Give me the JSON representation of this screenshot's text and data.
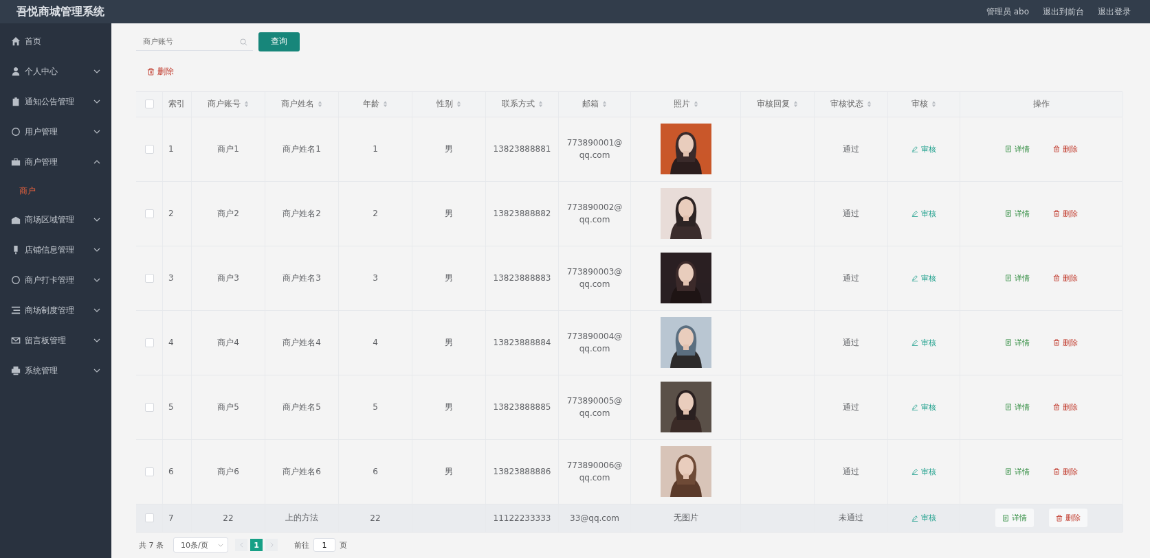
{
  "header": {
    "title": "吾悦商城管理系统",
    "links": [
      "管理员 abo",
      "退出到前台",
      "退出登录"
    ]
  },
  "sidebar": {
    "items": [
      {
        "label": "首页"
      },
      {
        "label": "个人中心",
        "expanded": false
      },
      {
        "label": "通知公告管理",
        "expanded": false
      },
      {
        "label": "用户管理",
        "expanded": false
      },
      {
        "label": "商户管理",
        "expanded": true,
        "children": [
          {
            "label": "商户",
            "selected": true
          }
        ]
      },
      {
        "label": "商场区域管理",
        "expanded": false
      },
      {
        "label": "店铺信息管理",
        "expanded": false
      },
      {
        "label": "商户打卡管理",
        "expanded": false
      },
      {
        "label": "商场制度管理",
        "expanded": false
      },
      {
        "label": "留言板管理",
        "expanded": false
      },
      {
        "label": "系统管理",
        "expanded": false
      }
    ]
  },
  "search": {
    "placeholder": "商户账号",
    "button": "查询"
  },
  "bulk_delete": "删除",
  "table": {
    "header_checked": false,
    "columns": [
      {
        "label": "索引",
        "sortable": false
      },
      {
        "label": "商户账号",
        "sortable": true
      },
      {
        "label": "商户姓名",
        "sortable": true
      },
      {
        "label": "年龄",
        "sortable": true
      },
      {
        "label": "性别",
        "sortable": true
      },
      {
        "label": "联系方式",
        "sortable": true
      },
      {
        "label": "邮箱",
        "sortable": true
      },
      {
        "label": "照片",
        "sortable": true
      },
      {
        "label": "审核回复",
        "sortable": true
      },
      {
        "label": "审核状态",
        "sortable": true
      },
      {
        "label": "审核",
        "sortable": true
      },
      {
        "label": "操作",
        "sortable": false
      }
    ],
    "rows": [
      {
        "checked": false,
        "hovered": false,
        "index": "1",
        "account": "商户1",
        "name": "商户姓名1",
        "age": "1",
        "gender": "男",
        "phone": "13823888881",
        "email": "773890001@qq.com",
        "status": "通过",
        "review": "审核",
        "detail": "详情",
        "delete": "删除"
      },
      {
        "checked": false,
        "hovered": false,
        "index": "2",
        "account": "商户2",
        "name": "商户姓名2",
        "age": "2",
        "gender": "男",
        "phone": "13823888882",
        "email": "773890002@qq.com",
        "status": "通过",
        "review": "审核",
        "detail": "详情",
        "delete": "删除"
      },
      {
        "checked": false,
        "hovered": false,
        "index": "3",
        "account": "商户3",
        "name": "商户姓名3",
        "age": "3",
        "gender": "男",
        "phone": "13823888883",
        "email": "773890003@qq.com",
        "status": "通过",
        "review": "审核",
        "detail": "详情",
        "delete": "删除"
      },
      {
        "checked": false,
        "hovered": false,
        "index": "4",
        "account": "商户4",
        "name": "商户姓名4",
        "age": "4",
        "gender": "男",
        "phone": "13823888884",
        "email": "773890004@qq.com",
        "status": "通过",
        "review": "审核",
        "detail": "详情",
        "delete": "删除"
      },
      {
        "checked": false,
        "hovered": false,
        "index": "5",
        "account": "商户5",
        "name": "商户姓名5",
        "age": "5",
        "gender": "男",
        "phone": "13823888885",
        "email": "773890005@qq.com",
        "status": "通过",
        "review": "审核",
        "detail": "详情",
        "delete": "删除"
      },
      {
        "checked": false,
        "hovered": false,
        "index": "6",
        "account": "商户6",
        "name": "商户姓名6",
        "age": "6",
        "gender": "男",
        "phone": "13823888886",
        "email": "773890006@qq.com",
        "status": "通过",
        "review": "审核",
        "detail": "详情",
        "delete": "删除"
      },
      {
        "checked": false,
        "hovered": true,
        "index": "7",
        "account": "22",
        "name": "上的方法",
        "age": "22",
        "phone": "11122233333",
        "email": "33@qq.com",
        "photo_text": "无图片",
        "status": "未通过",
        "review": "审核",
        "detail": "详情",
        "delete": "删除"
      }
    ]
  },
  "pagination": {
    "total": "共 7 条",
    "page_size": "10条/页",
    "pages": [
      {
        "label": "1",
        "selected": true
      }
    ],
    "goto_label": "前往",
    "goto_value": "1",
    "goto_suffix": "页"
  }
}
